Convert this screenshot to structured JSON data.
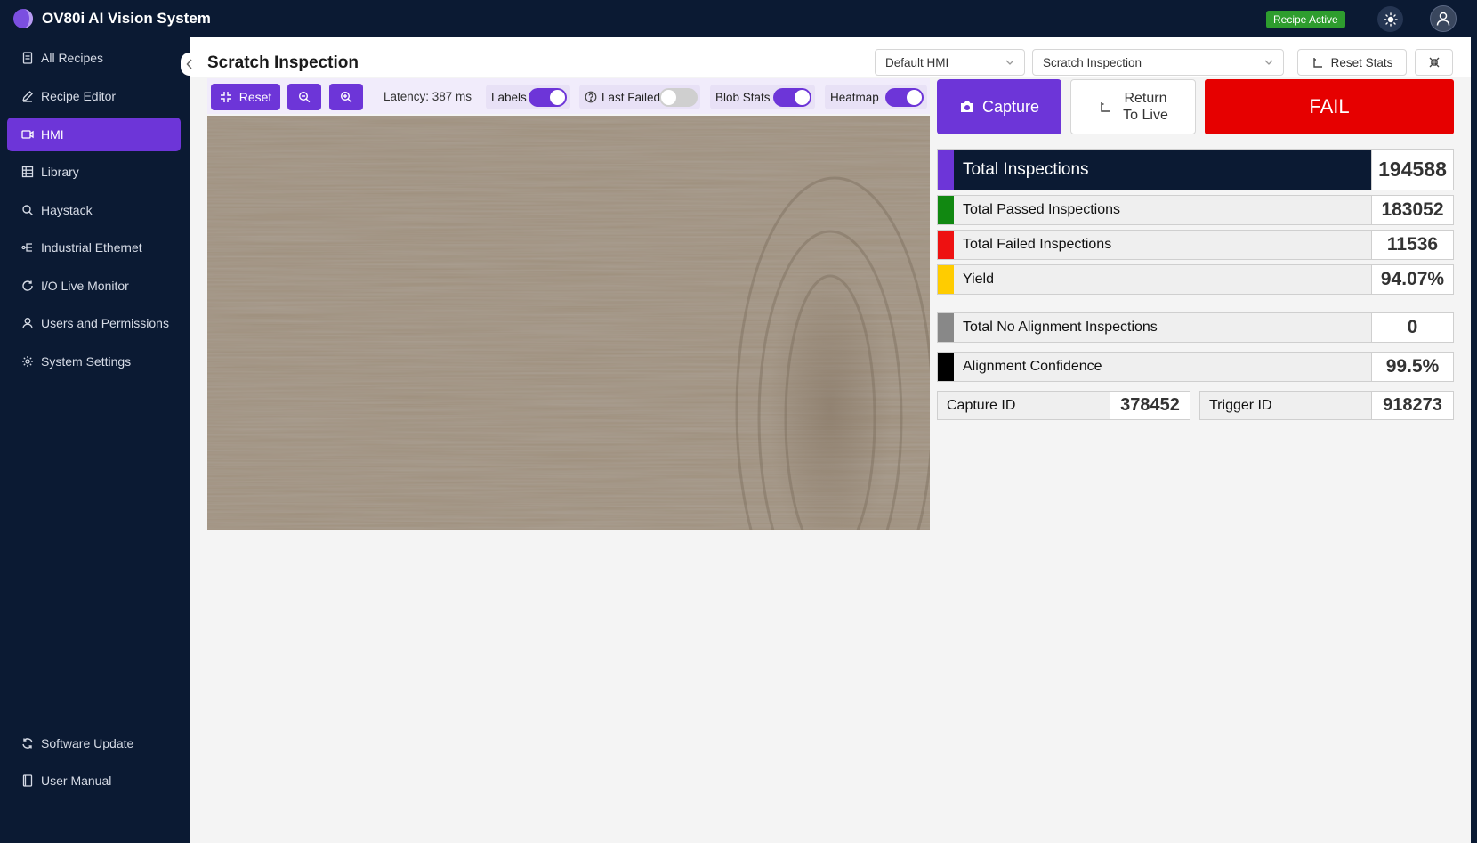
{
  "app": {
    "title": "OV80i AI Vision System",
    "status_badge": "Recipe Active"
  },
  "sidebar": {
    "items": [
      {
        "label": "All Recipes",
        "icon": "file-icon"
      },
      {
        "label": "Recipe Editor",
        "icon": "pencil-icon"
      },
      {
        "label": "HMI",
        "icon": "monitor-icon",
        "active": true
      },
      {
        "label": "Library",
        "icon": "grid-icon"
      },
      {
        "label": "Haystack",
        "icon": "search-icon"
      },
      {
        "label": "Industrial Ethernet",
        "icon": "network-icon"
      },
      {
        "label": "I/O Live Monitor",
        "icon": "refresh-icon"
      },
      {
        "label": "Users and Permissions",
        "icon": "user-icon"
      },
      {
        "label": "System Settings",
        "icon": "gear-icon"
      }
    ],
    "footer": [
      {
        "label": "Software Update",
        "icon": "sync-icon"
      },
      {
        "label": "User Manual",
        "icon": "book-icon"
      }
    ]
  },
  "header": {
    "page_title": "Scratch Inspection",
    "hmi_select": "Default HMI",
    "recipe_select": "Scratch Inspection",
    "reset_stats_label": "Reset Stats"
  },
  "toolbar": {
    "reset_label": "Reset",
    "latency": "Latency: 387 ms",
    "labels_toggle": {
      "label": "Labels",
      "on": true
    },
    "last_failed_toggle": {
      "label": "Last Failed",
      "on": false
    },
    "blob_stats_toggle": {
      "label": "Blob Stats",
      "on": true
    },
    "heatmap_toggle": {
      "label": "Heatmap",
      "on": true
    }
  },
  "actions": {
    "capture_label": "Capture",
    "return_line1": "Return",
    "return_line2": "To Live",
    "result": "FAIL"
  },
  "stats": {
    "total_inspections": {
      "label": "Total Inspections",
      "value": "194588"
    },
    "passed": {
      "label": "Total Passed Inspections",
      "value": "183052"
    },
    "failed": {
      "label": "Total Failed Inspections",
      "value": "11536"
    },
    "yield": {
      "label": "Yield",
      "value": "94.07%"
    },
    "no_alignment": {
      "label": "Total No Alignment Inspections",
      "value": "0"
    },
    "alignment_confidence": {
      "label": "Alignment Confidence",
      "value": "99.5%"
    },
    "capture_id": {
      "label": "Capture ID",
      "value": "378452"
    },
    "trigger_id": {
      "label": "Trigger ID",
      "value": "918273"
    }
  },
  "colors": {
    "accent": "#6d35d8",
    "nav_bg": "#0b1a33",
    "fail": "#e60000",
    "badge_green": "#2e9d2e",
    "bar_total": "#6d35d8",
    "bar_passed": "#118811",
    "bar_failed": "#ee1111",
    "bar_yield": "#ffcc00",
    "bar_no_alignment": "#888888",
    "bar_alignment": "#000000"
  }
}
